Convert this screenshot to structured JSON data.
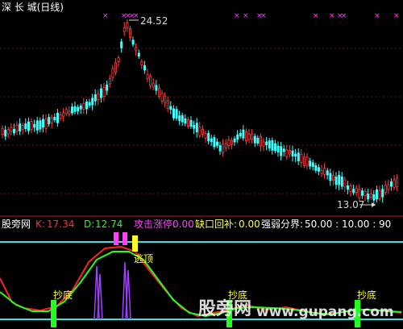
{
  "upper_panel": {
    "title": "深 长 城(日线)",
    "high_marker": "24.52",
    "low_marker": "13.07",
    "arrow_glyph": "→"
  },
  "lower_panel": {
    "indicator_name": "股旁网",
    "k_label": "K:",
    "k_value": "17.34",
    "d_label": "D:",
    "d_value": "12.74",
    "attack_label": "攻击涨停:",
    "attack_value": "0.00",
    "gap_label": "缺口回补:",
    "gap_value": "0.00",
    "strength_label": "强弱分界:",
    "strength_values": "50.00 : 10.00 : 90",
    "top_escape_label": "逃顶",
    "bottom_labels": [
      "抄底",
      "抄底",
      "抄底"
    ],
    "k_color": "#ff2020",
    "d_color": "#20ff20"
  },
  "watermark": {
    "brand": "股旁网",
    "url": "www.gupang.com"
  },
  "chart_data": [
    {
      "type": "line",
      "title": "深 长 城(日线)",
      "annotations": [
        {
          "text": "24.52",
          "meaning": "period high"
        },
        {
          "text": "13.07",
          "meaning": "period low"
        }
      ]
    },
    {
      "type": "line",
      "title": "股旁网",
      "series": [
        {
          "name": "K",
          "last_value": 17.34
        },
        {
          "name": "D",
          "last_value": 12.74
        }
      ],
      "reference_lines": [
        10,
        90
      ]
    }
  ]
}
